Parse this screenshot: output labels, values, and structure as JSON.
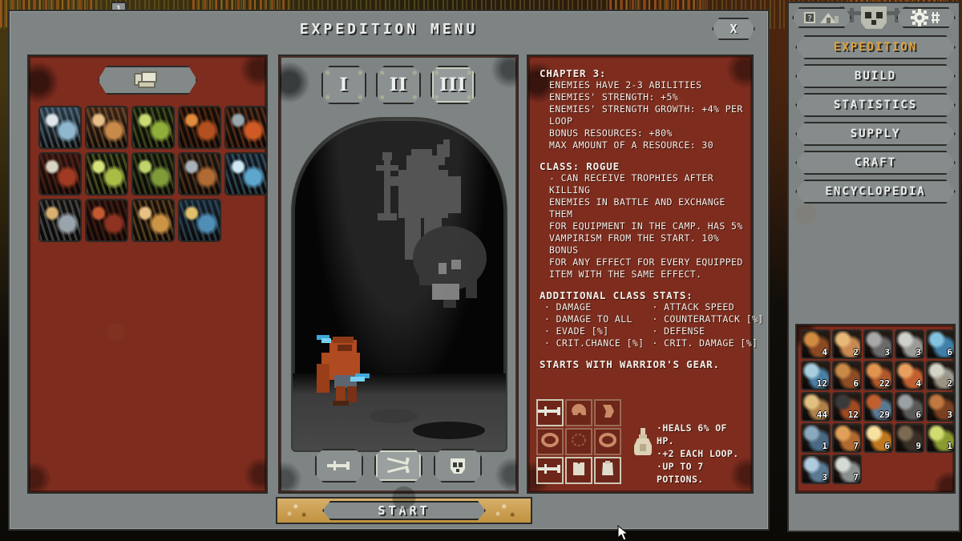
{
  "window": {
    "title": "EXPEDITION MENU",
    "close_label": "X"
  },
  "top_badge": "1",
  "cards": {
    "type_toggle_icon": "cards-stack-icon",
    "tiles": [
      {
        "name": "lich-card",
        "c1": "#8fb8cf",
        "c2": "#dfe6ea",
        "c3": "#2a3c49"
      },
      {
        "name": "ruins-card",
        "c1": "#c98a4a",
        "c2": "#e8c087",
        "c3": "#3a2417"
      },
      {
        "name": "grove-card",
        "c1": "#8fae3a",
        "c2": "#cadb72",
        "c3": "#14180c"
      },
      {
        "name": "spider-card",
        "c1": "#b4501f",
        "c2": "#e08a3c",
        "c3": "#170d07"
      },
      {
        "name": "battlefield-card",
        "c1": "#cf5a25",
        "c2": "#9aa6ad",
        "c3": "#1a1410"
      },
      {
        "name": "blood-grove-card",
        "c1": "#a03a22",
        "c2": "#d9d4c6",
        "c3": "#2a1410"
      },
      {
        "name": "wheat-field-card",
        "c1": "#a9bd46",
        "c2": "#d6e27a",
        "c3": "#12160b"
      },
      {
        "name": "forest-card",
        "c1": "#7f9b3a",
        "c2": "#c0d46c",
        "c3": "#10140a"
      },
      {
        "name": "graveyard-card",
        "c1": "#b06a34",
        "c2": "#a8b2ba",
        "c3": "#1b1510"
      },
      {
        "name": "ice-cave-card",
        "c1": "#5da7cf",
        "c2": "#cfe8f4",
        "c3": "#141c24"
      },
      {
        "name": "bookery-card",
        "c1": "#9aa4ac",
        "c2": "#d8b070",
        "c3": "#13110e"
      },
      {
        "name": "bloodstone-card",
        "c1": "#8e3322",
        "c2": "#c55a32",
        "c3": "#190d09"
      },
      {
        "name": "desert-card",
        "c1": "#cc9445",
        "c2": "#e8c083",
        "c3": "#1a1008"
      },
      {
        "name": "treasury-card",
        "c1": "#4f8fb7",
        "c2": "#e0c06a",
        "c3": "#16202a"
      }
    ]
  },
  "chapters": {
    "options": [
      "I",
      "II",
      "III"
    ],
    "selected": "III"
  },
  "classes": {
    "options": [
      {
        "id": "warrior",
        "icon": "sword-icon"
      },
      {
        "id": "rogue",
        "icon": "crossed-daggers-icon"
      },
      {
        "id": "necromancer",
        "icon": "skull-icon"
      }
    ],
    "selected": "rogue"
  },
  "info": {
    "chapter_heading": "CHAPTER 3:",
    "chapter_lines": [
      "ENEMIES HAVE 2-3 ABILITIES",
      "ENEMIES' STRENGTH: +5%",
      "ENEMIES' STRENGTH GROWTH: +4% PER",
      "LOOP",
      "BONUS RESOURCES: +80%",
      "MAX AMOUNT OF A RESOURCE: 30"
    ],
    "class_heading": "CLASS: ROGUE",
    "class_lines": [
      "- CAN RECEIVE TROPHIES AFTER KILLING",
      "ENEMIES IN BATTLE AND EXCHANGE THEM",
      "FOR EQUIPMENT IN THE CAMP. HAS 5%",
      "VAMPIRISM FROM THE START. 10% BONUS",
      "FOR ANY EFFECT FOR EVERY EQUIPPED",
      "ITEM WITH THE SAME EFFECT."
    ],
    "stats_heading": "ADDITIONAL CLASS STATS:",
    "stats_left": [
      "DAMAGE",
      "DAMAGE TO ALL",
      "EVADE [%]",
      "CRIT.CHANCE [%]"
    ],
    "stats_right": [
      "ATTACK SPEED",
      "COUNTERATTACK [%]",
      "DEFENSE",
      "CRIT. DAMAGE [%]"
    ],
    "gear_note": "STARTS WITH WARRIOR'S GEAR.",
    "potion_lines": [
      "·HEALS 6% OF HP.",
      "·+2 EACH LOOP.",
      "·UP TO 7 POTIONS."
    ],
    "gear_slots": [
      {
        "name": "sword-slot",
        "icon": "sword-icon",
        "lit": true
      },
      {
        "name": "helmet-slot",
        "icon": "helmet-icon",
        "lit": false
      },
      {
        "name": "bracers-slot",
        "icon": "bracers-icon",
        "lit": false
      },
      {
        "name": "ring-slot",
        "icon": "ring-icon",
        "lit": false
      },
      {
        "name": "amulet-slot",
        "icon": "amulet-icon",
        "lit": false
      },
      {
        "name": "ring2-slot",
        "icon": "ring-icon",
        "lit": false
      },
      {
        "name": "shield-slot",
        "icon": "sword-icon",
        "lit": true
      },
      {
        "name": "armor-slot",
        "icon": "armor-icon",
        "lit": true
      },
      {
        "name": "cloak-slot",
        "icon": "cloak-icon",
        "lit": true
      }
    ]
  },
  "start_button": "START",
  "sidebar": {
    "help_icon": "help-book-icon",
    "settings_icon": "gear-icon",
    "banner_icon": "skull-banner-icon",
    "menu": [
      {
        "label": "EXPEDITION",
        "active": true
      },
      {
        "label": "BUILD",
        "active": false
      },
      {
        "label": "STATISTICS",
        "active": false
      },
      {
        "label": "SUPPLY",
        "active": false
      },
      {
        "label": "CRAFT",
        "active": false
      },
      {
        "label": "ENCYCLOPEDIA",
        "active": false
      }
    ],
    "inventory": [
      {
        "name": "branch-item",
        "qty": "4",
        "c1": "#8a4a22",
        "c2": "#d08a40"
      },
      {
        "name": "hand-item",
        "qty": "2",
        "c1": "#c88a52",
        "c2": "#e8b878"
      },
      {
        "name": "scrap-item",
        "qty": "3",
        "c1": "#6a6a6a",
        "c2": "#a8a8a8"
      },
      {
        "name": "stone-item",
        "qty": "3",
        "c1": "#9a9a96",
        "c2": "#d0d0cc"
      },
      {
        "name": "blue-shard-item",
        "qty": "6",
        "c1": "#3f7fa8",
        "c2": "#82c4e0"
      },
      {
        "name": "orb-item",
        "qty": "12",
        "c1": "#4b7fa4",
        "c2": "#a8cede"
      },
      {
        "name": "claw-item",
        "qty": "6",
        "c1": "#8c4c24",
        "c2": "#c88a46"
      },
      {
        "name": "flesh-item",
        "qty": "22",
        "c1": "#b0582a",
        "c2": "#e09450"
      },
      {
        "name": "brain-item",
        "qty": "4",
        "c1": "#c06030",
        "c2": "#e8a060"
      },
      {
        "name": "skull-item",
        "qty": "2",
        "c1": "#9a9a90",
        "c2": "#d4d4c8"
      },
      {
        "name": "scroll-item",
        "qty": "44",
        "c1": "#b08048",
        "c2": "#e0c080"
      },
      {
        "name": "horn-item",
        "qty": "12",
        "c1": "#a04a22",
        "c2": "#3a3a3a"
      },
      {
        "name": "metal-ball-item",
        "qty": "29",
        "c1": "#5a7a94",
        "c2": "#c06030"
      },
      {
        "name": "talon-item",
        "qty": "6",
        "c1": "#5a5a58",
        "c2": "#9aa0a4"
      },
      {
        "name": "spider-leg-item",
        "qty": "3",
        "c1": "#7a4020",
        "c2": "#c07840"
      },
      {
        "name": "gear-item",
        "qty": "1",
        "c1": "#4a6a84",
        "c2": "#8aa8be"
      },
      {
        "name": "feather-item",
        "qty": "7",
        "c1": "#b06a30",
        "c2": "#e0a058"
      },
      {
        "name": "orb-gold-item",
        "qty": "6",
        "c1": "#c07820",
        "c2": "#f8e0a0"
      },
      {
        "name": "coal-item",
        "qty": "9",
        "c1": "#3a3028",
        "c2": "#7a6a50"
      },
      {
        "name": "fungus-item",
        "qty": "1",
        "c1": "#8a9a30",
        "c2": "#d0dc70"
      },
      {
        "name": "helm-item",
        "qty": "3",
        "c1": "#5a7a94",
        "c2": "#b0cade"
      },
      {
        "name": "bone-helm-item",
        "qty": "7",
        "c1": "#8a9090",
        "c2": "#d4dad4"
      }
    ]
  },
  "colors": {
    "panel_red": "#7d2c1e",
    "ui_gray": "#7e8484",
    "accent_gold": "#e0a33c",
    "text": "#f3f0e8"
  }
}
